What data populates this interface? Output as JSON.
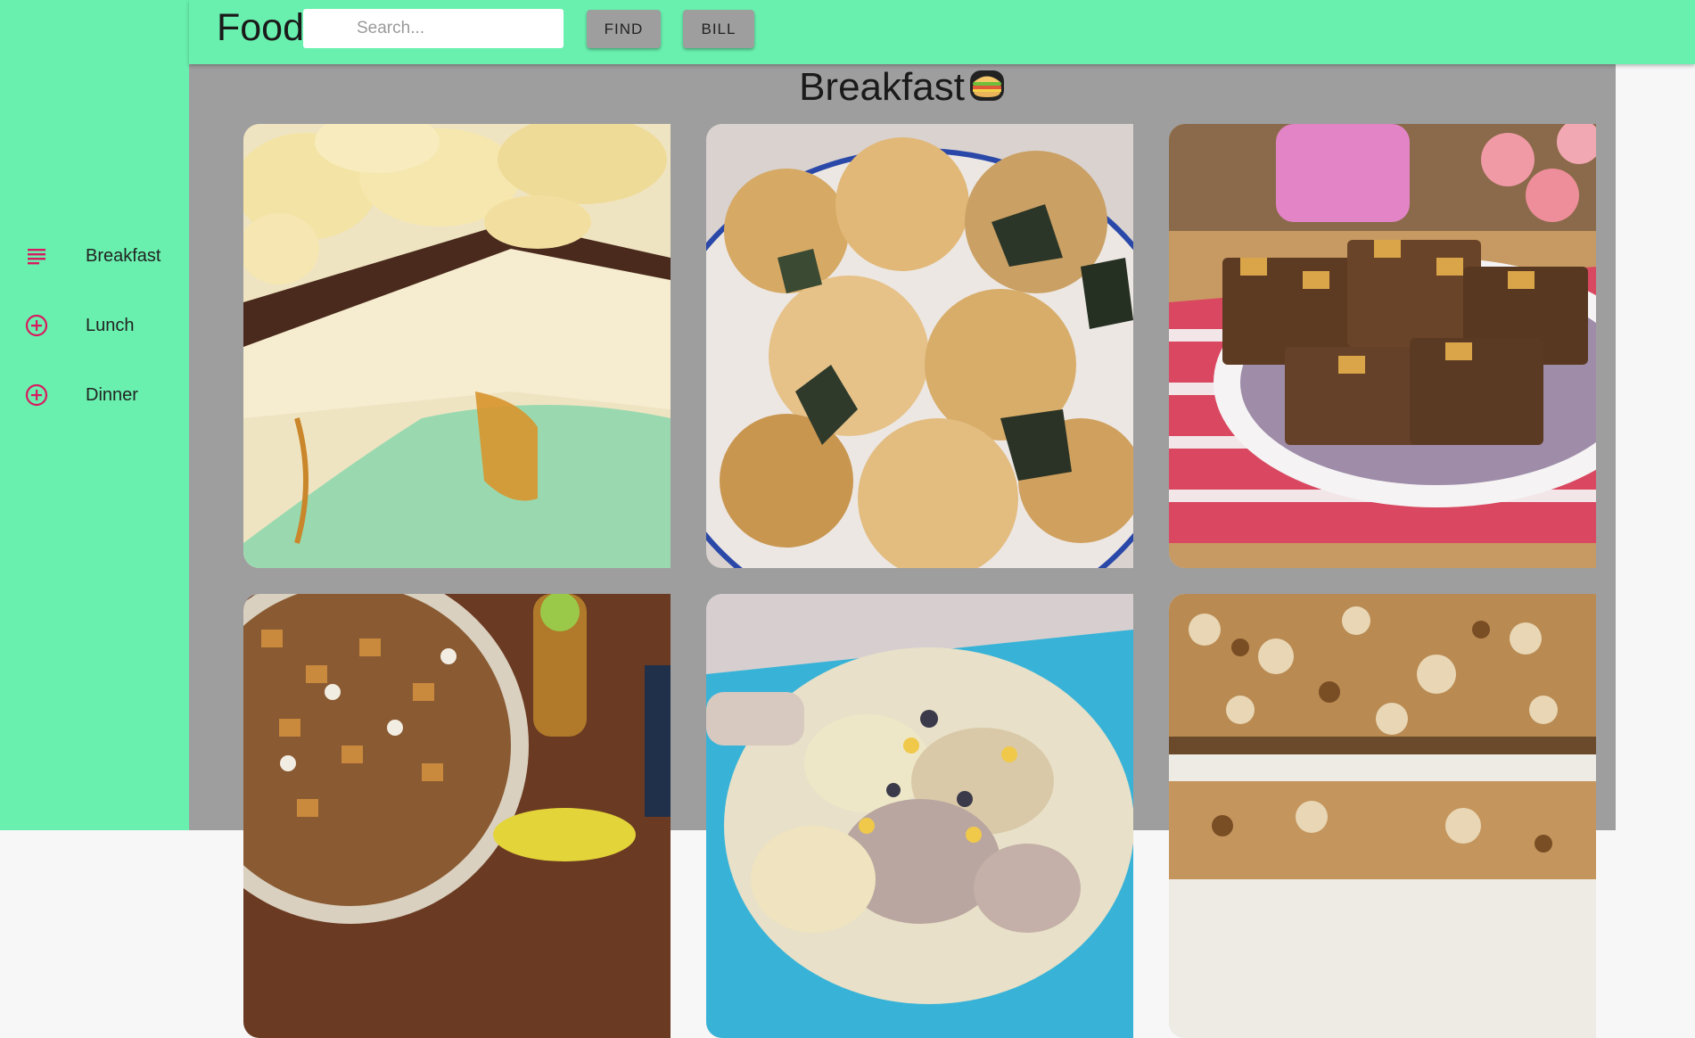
{
  "app": {
    "brand": "Food"
  },
  "search": {
    "placeholder": "Search..."
  },
  "toolbar": {
    "find_label": "FIND",
    "bill_label": "BILL"
  },
  "sidebar": {
    "items": [
      {
        "label": "Breakfast",
        "icon": "list-icon"
      },
      {
        "label": "Lunch",
        "icon": "add-circle-icon"
      },
      {
        "label": "Dinner",
        "icon": "add-circle-icon"
      }
    ]
  },
  "section": {
    "title": "Breakfast",
    "emoji": "sandwich-icon"
  },
  "colors": {
    "accent": "#69f0ae",
    "icon": "#d81b60",
    "content_bg": "#9e9e9e"
  },
  "cards": [
    {
      "image": "ice-cream-cake-with-potato-chips"
    },
    {
      "image": "seasoned-potato-chips-with-seaweed"
    },
    {
      "image": "snack-mix-brownie-bars-on-plate"
    },
    {
      "image": "chex-party-mix-in-bowl"
    },
    {
      "image": "chicken-casserole-on-blue-plate"
    },
    {
      "image": "coconut-seven-layer-bars"
    }
  ]
}
